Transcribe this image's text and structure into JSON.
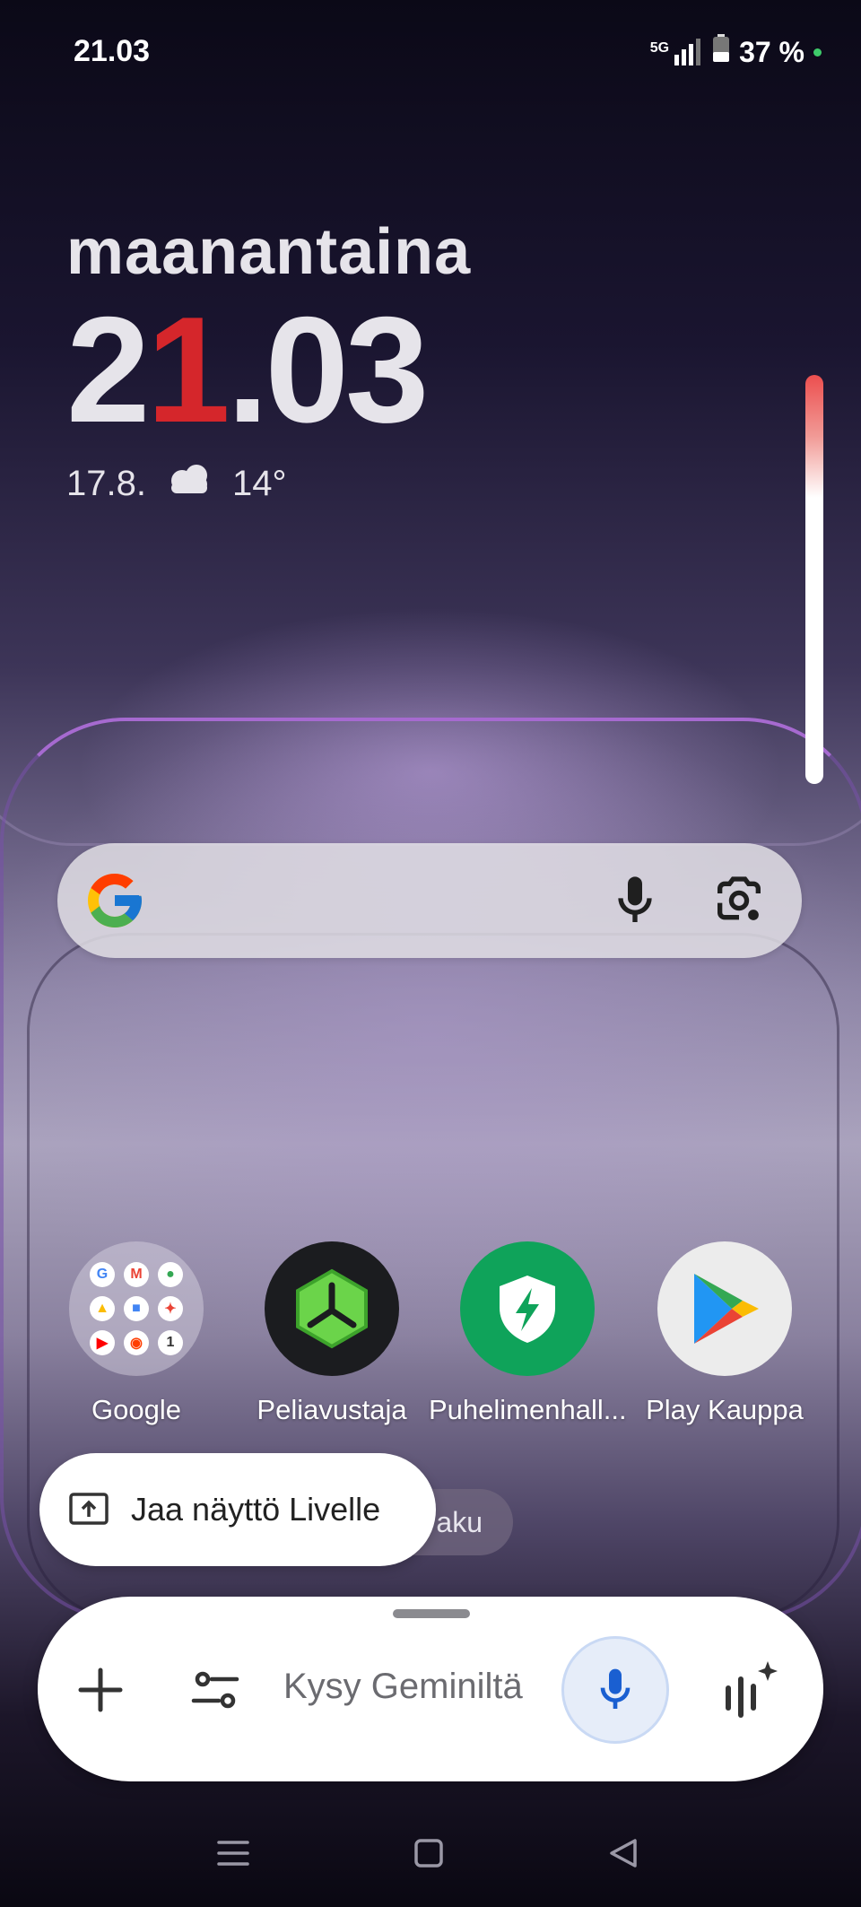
{
  "status": {
    "time": "21.03",
    "network": "5G",
    "battery": "37 %"
  },
  "clock": {
    "weekday": "maanantaina",
    "hours": "2",
    "hours_red": "1",
    "minutes": ".03",
    "date": "17.8.",
    "temperature": "14°"
  },
  "apps": [
    {
      "label": "Google",
      "icon": "google-folder-icon"
    },
    {
      "label": "Peliavustaja",
      "icon": "game-assistant-icon"
    },
    {
      "label": "Puhelimenhall...",
      "icon": "phone-manager-icon"
    },
    {
      "label": "Play Kauppa",
      "icon": "play-store-icon"
    }
  ],
  "hidden_pill": {
    "label": "aku"
  },
  "share_pill": {
    "label": "Jaa näyttö Livelle"
  },
  "gemini": {
    "placeholder": "Kysy Geminiltä"
  },
  "colors": {
    "clock_accent": "#d5262b",
    "gemini_mic": "#1a5fd1"
  }
}
